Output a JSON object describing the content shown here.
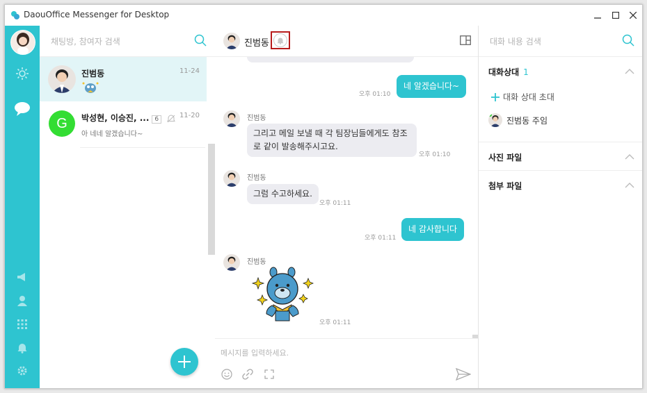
{
  "window": {
    "title": "DaouOffice Messenger for Desktop"
  },
  "list": {
    "search_placeholder": "채팅방, 참여자 검색",
    "rooms": [
      {
        "name": "진범동",
        "date": "11-24",
        "preview": ""
      },
      {
        "name": "박성현, 이승진, ...",
        "badge": "6",
        "date": "11-20",
        "preview": "아 네네 알겠습니다~",
        "initial": "G"
      }
    ]
  },
  "chat": {
    "header_name": "진범동",
    "composer_placeholder": "메시지를 입력하세요.",
    "messages": [
      {
        "type": "out",
        "text": "네 알겠습니다~",
        "time": "오후 01:10"
      },
      {
        "type": "in",
        "sender": "진범동",
        "lines": [
          "그리고 메일 보낼 때 각 팀장님들에게도 참조",
          "로 같이 발송해주시고요."
        ],
        "time": "오후 01:10"
      },
      {
        "type": "in",
        "sender": "진범동",
        "lines": [
          "그럼 수고하세요."
        ],
        "time": "오후 01:11"
      },
      {
        "type": "out",
        "text": "네 감사합니다",
        "time": "오후 01:11"
      },
      {
        "type": "sticker",
        "sender": "진범동",
        "time": "오후 01:11"
      }
    ]
  },
  "info": {
    "search_placeholder": "대화 내용 검색",
    "participants_title": "대화상대",
    "participants_count": "1",
    "invite_label": "대화 상대 초대",
    "member_name": "진범동 주임",
    "photos_title": "사진 파일",
    "files_title": "첨부 파일"
  },
  "colors": {
    "accent": "#2ec4d0",
    "highlight": "#b71c1c",
    "group_avatar": "#33dd33"
  }
}
